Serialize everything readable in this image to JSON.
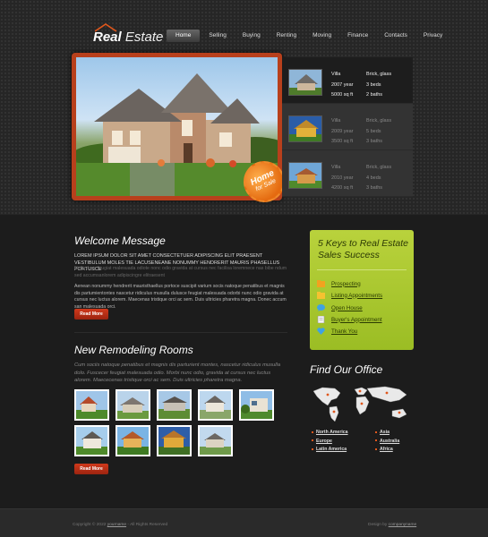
{
  "brand": {
    "name_1": "Real",
    "name_2": " Estate"
  },
  "nav": [
    "Home",
    "Selling",
    "Buying",
    "Renting",
    "Moving",
    "Finance",
    "Contacts",
    "Privacy"
  ],
  "badge": {
    "line1": "Home",
    "line2": "for Sale"
  },
  "listings": [
    {
      "type": "Villa",
      "year": "2007 year",
      "size": "5000 sq ft",
      "material": "Brick, glass",
      "beds": "3 beds",
      "baths": "2 baths"
    },
    {
      "type": "Villa",
      "year": "2009 year",
      "size": "3500 sq ft",
      "material": "Brick, glass",
      "beds": "5 beds",
      "baths": "3 baths"
    },
    {
      "type": "Villa",
      "year": "2010 year",
      "size": "4200 sq ft",
      "material": "Brick, glass",
      "beds": "4 beds",
      "baths": "3 baths"
    }
  ],
  "welcome": {
    "title": "Welcome Message",
    "caps": "LOREM IPSUM DOLOR SIT AMET CONSECTETUER ADIPISCING ELIT PRAESENT VESTIBULUM MOLES TIE LACUSENEANE NONUMMY HENDRERIT MAURIS PHASELLUS PORTUSCE",
    "grey": "Nulla dace feugiat malesuada odiote nonc odio gravida at cursus nec facilisa loremnece nas bibe ndum sed accumsanlorem adipiscingre elitraesent",
    "body": "Aenean nonummy hendrerit mauristhaellus portoce suscipit varium socis natoque penatibus et magnis dis partumientontes nascetur ridiculus musulla dulusce feugiat malesuada odorbi nunc odio gravida at cursus nec luctus alorem. Maecenas tristique orci ac sem. Duis ultricies pharetra magna. Donec accum san malesuada orci.",
    "button": "Read More"
  },
  "rooms": {
    "title": "New Remodeling Rooms",
    "text": "Cum sociis natoque penatibus et magnis dis parturient montes, nascetur ridiculus musulla dolo. Fuscecer feugiat malesuada odio. Morbi nunc odio, gravida at cursus nec luctus alorem. Maececenas tristique orci ac sem. Duis ultricies pharetra magna.",
    "button": "Read More"
  },
  "keys": {
    "title": "5 Keys to Real Estate Sales Success",
    "items": [
      "Prospecting",
      "Listing Appointments",
      "Open House",
      "Buyer's Appointment",
      "Thank You"
    ]
  },
  "office": {
    "title": "Find Our Office",
    "regions": [
      "North America",
      "Europe",
      "Latin America",
      "Asia",
      "Australia",
      "Africa"
    ]
  },
  "footer": {
    "copyright": "Copyright © 2022 ",
    "copyright_link": "yourname",
    "rights": " - All Rights Reserved",
    "design_by": "Design by ",
    "design_link": "companyname"
  },
  "colors": {
    "accent_orange": "#b8401c",
    "keys_green": "#b2cc36",
    "button_red": "#c1321a"
  }
}
